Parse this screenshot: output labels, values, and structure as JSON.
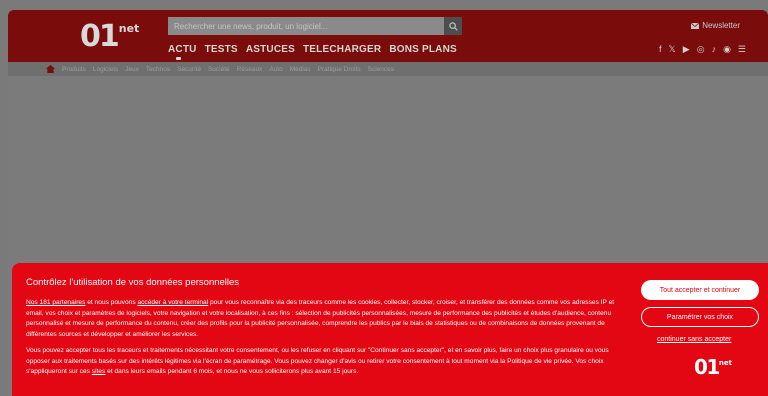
{
  "header": {
    "logo_main": "01",
    "logo_suffix": "net",
    "search_placeholder": "Rechercher une news, produit, un logiciel...",
    "newsletter_label": "Newsletter",
    "nav": [
      "ACTU",
      "TESTS",
      "ASTUCES",
      "TELECHARGER",
      "BONS PLANS"
    ],
    "social_icons": [
      "facebook-icon",
      "x-icon",
      "youtube-icon",
      "instagram-icon",
      "tiktok-icon",
      "rss-icon",
      "menu-icon"
    ]
  },
  "subnav": [
    "Produits",
    "Logiciels",
    "Jeux",
    "Technos",
    "Sécurité",
    "Société",
    "Réseaux",
    "Auto",
    "Médias",
    "Pratique Droits",
    "Sciences"
  ],
  "consent": {
    "title": "Contrôlez l'utilisation de vos données personnelles",
    "p1_link1": "Nos 181 partenaires",
    "p1_mid": " et nous pouvons ",
    "p1_link2": "accéder à votre terminal",
    "p1_rest": " pour vous reconnaître via des traceurs comme les cookies, collecter, stocker, croiser, et transférer des données comme vos adresses IP et email, vos choix et paramètres de logiciels, votre navigation et votre localisation, à ces fins : sélection de publicités personnalisées, mesure de performance des publicités et études d'audience, contenu personnalisé et mesure de performance du contenu, créer des profils pour la publicité personnalisée, comprendre les publics par le biais de statistiques ou de combinaisons de données provenant de différentes sources et développer et améliorer les services.",
    "p2_start": "Vous pouvez accepter tous les traceurs et traitements nécessitant votre consentement, ou les refuser en cliquant sur \"Continuer sans accepter\", et en savoir plus, faire un choix plus granulaire ou vous opposer aux traitements basés sur des intérêts légitimes via l'écran de paramétrage. Vous pouvez changer d'avis ou retirer votre consentement à tout moment via la Politique de vie privée. Vos choix s'appliqueront sur ces ",
    "p2_link": "sites",
    "p2_end": " et dans leurs emails pendant 6 mois, et nous ne vous solliciterons plus avant 15 jours.",
    "accept_label": "Tout accepter et continuer",
    "params_label": "Paramétrer vos choix",
    "continue_label": "continuer sans accepter",
    "logo_main": "01",
    "logo_suffix": "net"
  },
  "colors": {
    "brand_red": "#e30613",
    "header_dark_red": "#7a0c0c",
    "overlay_gray": "#7b7b7b"
  }
}
